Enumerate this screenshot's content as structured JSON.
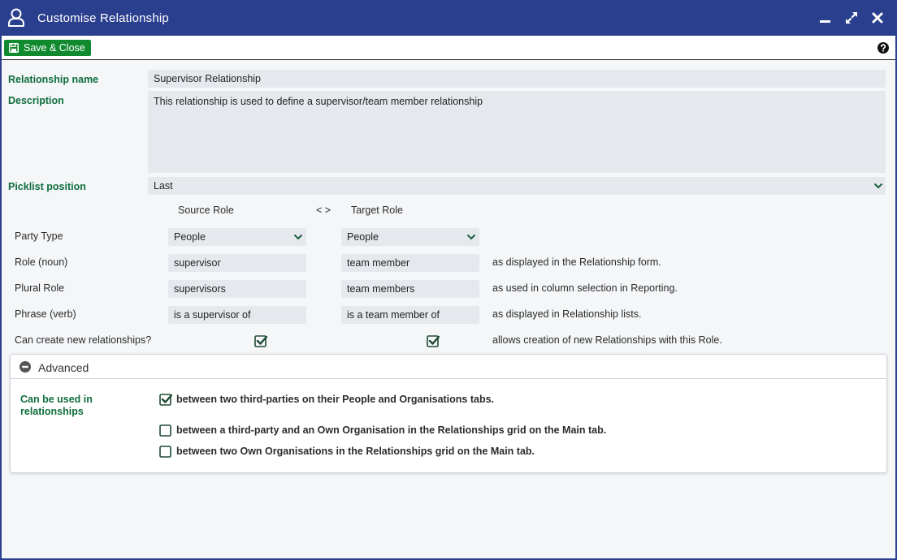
{
  "window": {
    "title": "Customise Relationship"
  },
  "toolbar": {
    "save_label": "Save & Close"
  },
  "form": {
    "name_label": "Relationship name",
    "name_value": "Supervisor Relationship",
    "description_label": "Description",
    "description_value": "This relationship is used to define a supervisor/team member relationship",
    "picklist_label": "Picklist position",
    "picklist_value": "Last"
  },
  "roles": {
    "source_header": "Source Role",
    "separator": "< >",
    "target_header": "Target Role",
    "rows": [
      {
        "label": "Party Type",
        "source": "People",
        "target": "People",
        "note": ""
      },
      {
        "label": "Role (noun)",
        "source": "supervisor",
        "target": "team member",
        "note": "as displayed in the Relationship form."
      },
      {
        "label": "Plural Role",
        "source": "supervisors",
        "target": "team members",
        "note": "as used in column selection in Reporting."
      },
      {
        "label": "Phrase (verb)",
        "source": "is a supervisor of",
        "target": "is a team member of",
        "note": "as displayed in Relationship lists."
      }
    ],
    "create_label": "Can create new relationships?",
    "create_source_checked": true,
    "create_target_checked": true,
    "create_note": "allows creation of new Relationships with this Role."
  },
  "advanced": {
    "title": "Advanced",
    "used_in_label": "Can be used in relationships",
    "options": [
      {
        "label": "between two third-parties on their People and Organisations tabs.",
        "checked": true
      },
      {
        "label": "between a third-party and an Own Organisation in the Relationships grid on the Main tab.",
        "checked": false
      },
      {
        "label": "between two Own Organisations in the Relationships grid on the Main tab.",
        "checked": false
      }
    ]
  },
  "colors": {
    "titlebar": "#2b3f8f",
    "save_button": "#118a2f",
    "label_green": "#0f6e3c",
    "field_bg": "#e5e9ee"
  }
}
